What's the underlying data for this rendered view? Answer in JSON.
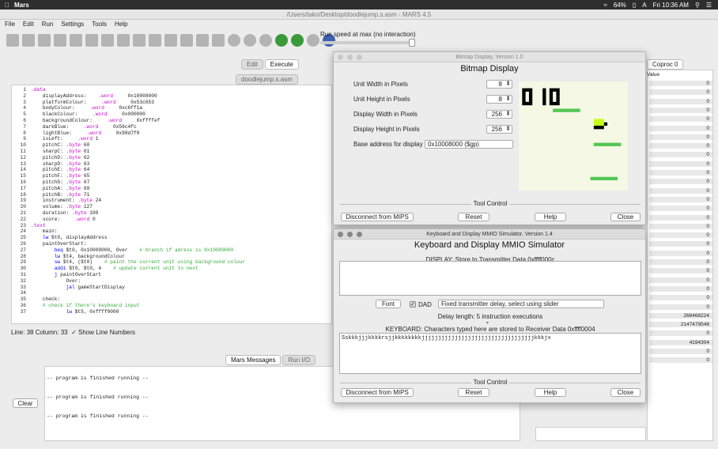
{
  "menubar": {
    "app": "Mars",
    "battery": "64%",
    "clock": "Fri 10:36 AM",
    "input_source": "A"
  },
  "window": {
    "title": "/Users/tako/Desktop/doodlejump.s.asm - MARS 4.5"
  },
  "app_menu": [
    "File",
    "Edit",
    "Run",
    "Settings",
    "Tools",
    "Help"
  ],
  "toolbar": {
    "run_speed_label": "Run speed at max (no interaction)",
    "run_speed_fraction": 1.0
  },
  "editor": {
    "tabs": [
      "Edit",
      "Execute"
    ],
    "file_tab": "doodlejump.s.asm",
    "line_numbers": [
      "1",
      "2",
      "3",
      "4",
      "5",
      "6",
      "7",
      "8",
      "9",
      "10",
      "11",
      "12",
      "13",
      "14",
      "15",
      "16",
      "17",
      "18",
      "19",
      "20",
      "21",
      "22",
      "23",
      "24",
      "25",
      "26",
      "27",
      "28",
      "29",
      "30",
      "31",
      "32",
      "33",
      "34",
      "35",
      "36",
      "37"
    ],
    "code_lines": [
      ".data",
      "    displayAddress:    .word     0x10008000",
      "    platformColour:     .word     0x53c653",
      "    bodyColour:     .word     0xc6ff1a",
      "    blackColour:     .word     0x000000",
      "    backgroundColour:     .word     0xffffef",
      "    darkBlue:     .word     0x56c4fc",
      "    lightBlue:     .word     0x98d7f8",
      "    isLeft:     .word 1",
      "    pitchC: .byte 60",
      "    sharpC: .byte 61",
      "    pitchD: .byte 62",
      "    sharpD: .byte 63",
      "    pitchE: .byte 64",
      "    pitchF: .byte 65",
      "    pitchG: .byte 67",
      "    pitchA: .byte 69",
      "    pitchB: .byte 71",
      "    instrument: .byte 24",
      "    volume: .byte 127",
      "    duration: .byte 100",
      "    score:     .word 0",
      ".text",
      "    main:",
      "    lw $t0, displayAddress",
      "    paintOverStart:",
      "        beq $t0, 0x10009000, Over    # branch if adress is 0x10009000",
      "        lw $t4, backgroundColour",
      "        sw $t4, ($t0)    # paint the current unit using background colour",
      "        addi $t0, $t0, 4    # update current unit to next",
      "        j paintOverStart",
      "            Over:",
      "            jal gameStartDisplay",
      "",
      "    check:",
      "    # check if there's keyboard input",
      "            lw $t5, 0xffff0000"
    ],
    "status": "Line: 38 Column: 33",
    "show_line_numbers_label": "Show Line Numbers"
  },
  "messages": {
    "tabs": [
      "Mars Messages",
      "Run I/O"
    ],
    "clear_label": "Clear",
    "lines": [
      "-- program is finished running --",
      "-- program is finished running --",
      "-- program is finished running --"
    ]
  },
  "registers": {
    "tab": "Coproc 0",
    "value_header": "Value",
    "values": [
      "0",
      "0",
      "0",
      "0",
      "0",
      "0",
      "0",
      "0",
      "0",
      "0",
      "0",
      "0",
      "0",
      "0",
      "0",
      "0",
      "0",
      "0",
      "0",
      "0",
      "0",
      "0",
      "0",
      "0",
      "0",
      "0",
      "268468224",
      "2147479548",
      "0",
      "4194304",
      "0",
      "0"
    ]
  },
  "bitmap": {
    "window_title": "Bitmap Display, Version 1.0",
    "heading": "Bitmap Display",
    "unit_width_label": "Unit Width in Pixels",
    "unit_width": "8",
    "unit_height_label": "Unit Height in Pixels",
    "unit_height": "8",
    "display_width_label": "Display Width in Pixels",
    "display_width": "256",
    "display_height_label": "Display Height in Pixels",
    "display_height": "256",
    "base_address_label": "Base address for display",
    "base_address": "0x10008000 ($gp)",
    "tool_control": "Tool Control",
    "disconnect": "Disconnect from MIPS",
    "reset": "Reset",
    "help": "Help",
    "close": "Close",
    "colors": {
      "background": "#f5f8e4",
      "platform": "#53c653",
      "body": "#c6ff1a",
      "black": "#000000"
    }
  },
  "keyboard": {
    "window_title": "Keyboard and Display MMIO Simulator, Version 1.4",
    "heading": "Keyboard and Display MMIO Simulator",
    "display_label": "DISPLAY: Store to Transmitter Data 0xffff000c",
    "font_label": "Font",
    "dad_label": "DAD",
    "delay_select": "Fixed transmitter delay, select using slider",
    "delay_length": "Delay length: 5 instruction executions",
    "keyboard_label": "KEYBOARD: Characters typed here are stored to Receiver Data 0xffff0004",
    "typed_text": "Sskkkjjjkkkkrsjjkkkkkkkkjjjjjjjjjjjjjjjjjjjjjjjjjjjjjjjjjjkkkjx",
    "tool_control": "Tool Control",
    "disconnect": "Disconnect from MIPS",
    "reset": "Reset",
    "help": "Help",
    "close": "Close"
  }
}
